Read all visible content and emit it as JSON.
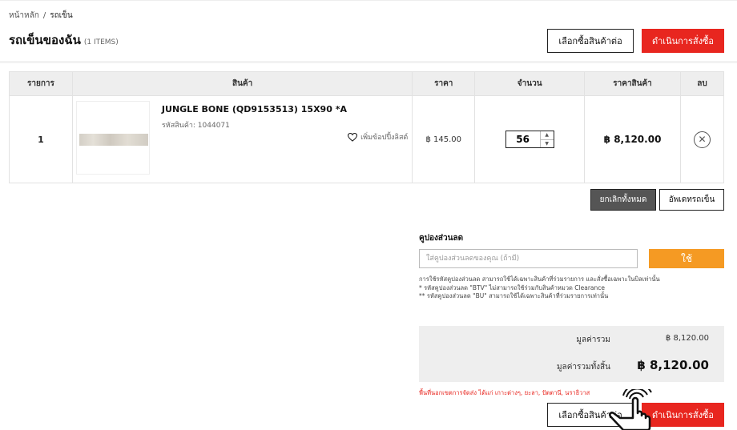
{
  "breadcrumb": {
    "home": "หน้าหลัก",
    "separator": "/",
    "current": "รถเข็น"
  },
  "header": {
    "title": "รถเข็นของฉัน",
    "items_count": "(1 ITEMS)",
    "continue_shopping": "เลือกซื้อสินค้าต่อ",
    "checkout": "ดำเนินการสั่งซื้อ"
  },
  "table": {
    "headers": [
      "รายการ",
      "สินค้า",
      "ราคา",
      "จำนวน",
      "ราคาสินค้า",
      "ลบ"
    ],
    "rows": [
      {
        "index": "1",
        "name": "JUNGLE BONE (QD9153513) 15X90 *A",
        "code": "รหัสสินค้า: 1044071",
        "wishlist": "เพิ่มข้อปปี้งลิสต์",
        "price": "฿ 145.00",
        "quantity": "56",
        "total": "฿ 8,120.00"
      }
    ]
  },
  "actions": {
    "clear_all": "ยกเลิกทั้งหมด",
    "update_cart": "อัพเดทรถเข็น"
  },
  "coupon": {
    "title": "คูปองส่วนลด",
    "placeholder": "ใส่คูปองส่วนลดของคุณ (ถ้ามี)",
    "apply": "ใช้",
    "notes": [
      "การใช้รหัสคูปองส่วนลด สามารถใช้ได้เฉพาะสินค้าที่ร่วมรายการ และสั่งซื้อเฉพาะในบิลเท่านั้น",
      "* รหัสคูปองส่วนลด \"BTV\" ไม่สามารถใช้ร่วมกับสินค้าหมวด Clearance",
      "** รหัสคูปองส่วนลด \"BU\" สามารถใช้ได้เฉพาะสินค้าที่ร่วมรายการเท่านั้น"
    ]
  },
  "summary": {
    "subtotal_label": "มูลค่ารวม",
    "subtotal": "฿ 8,120.00",
    "grand_total_label": "มูลค่ารวมทั้งสิ้น",
    "grand_total": "฿ 8,120.00"
  },
  "shipping_note": "พื้นที่นอกเขตการจัดส่ง ได้แก่ เกาะต่างๆ, ยะลา, ปัตตานี, นราธิวาส",
  "footer": {
    "continue_shopping": "เลือกซื้อสินค้าต่อ",
    "checkout": "ดำเนินการสั่งซื้อ"
  },
  "colors": {
    "accent_red": "#e8261f",
    "coupon_orange": "#f59a23",
    "dark_button": "#555555"
  },
  "icons": {
    "wishlist": "heart-icon",
    "remove": "close-circle-icon",
    "cursor": "hand-pointer-icon"
  }
}
